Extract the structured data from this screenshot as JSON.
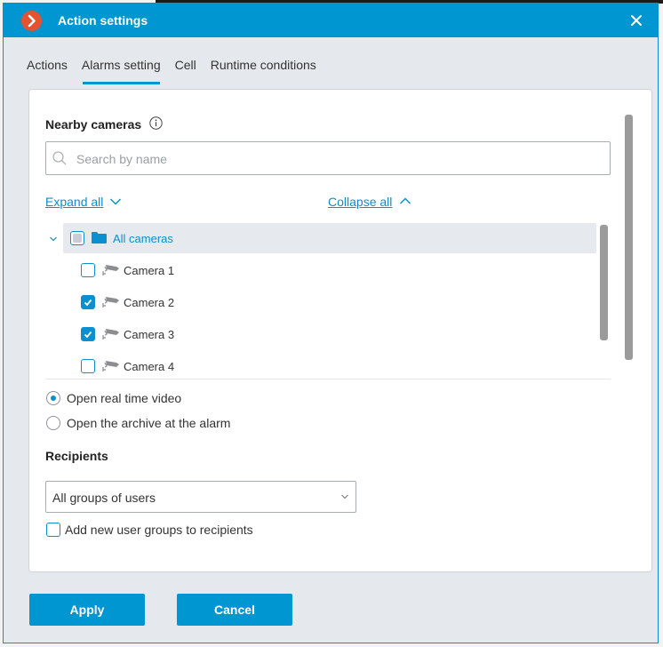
{
  "window": {
    "title": "Action settings",
    "close_label": "close",
    "accent_color": "#0096d2",
    "logo_color": "#e8512f"
  },
  "tabs": [
    {
      "label": "Actions",
      "active": false
    },
    {
      "label": "Alarms setting",
      "active": true
    },
    {
      "label": "Cell",
      "active": false
    },
    {
      "label": "Runtime conditions",
      "active": false
    }
  ],
  "nearby_cameras": {
    "title": "Nearby cameras",
    "search_placeholder": "Search by name",
    "search_value": "",
    "expand_all": "Expand all",
    "collapse_all": "Collapse all",
    "tree": {
      "root": {
        "label": "All cameras",
        "state": "partial",
        "expanded": true
      },
      "items": [
        {
          "label": "Camera 1",
          "checked": false
        },
        {
          "label": "Camera 2",
          "checked": true
        },
        {
          "label": "Camera 3",
          "checked": true
        },
        {
          "label": "Camera 4",
          "checked": false
        }
      ]
    }
  },
  "open_mode": {
    "options": [
      {
        "label": "Open real time video",
        "selected": true
      },
      {
        "label": "Open the archive at the alarm",
        "selected": false
      }
    ]
  },
  "recipients": {
    "title": "Recipients",
    "selected": "All groups of users",
    "add_new_groups_label": "Add new user groups to recipients",
    "add_new_groups_checked": false
  },
  "footer": {
    "apply_label": "Apply",
    "cancel_label": "Cancel"
  }
}
